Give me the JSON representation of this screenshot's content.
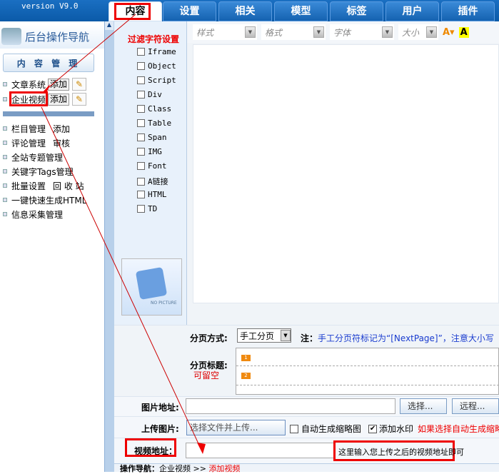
{
  "header": {
    "version": "version V9.0"
  },
  "tabs": [
    "内容",
    "设置",
    "相关",
    "模型",
    "标签",
    "用户",
    "插件"
  ],
  "sidebar": {
    "title": "后台操作导航",
    "section": "内 容 管 理",
    "modules": [
      {
        "label": "文章系统",
        "add": "添加"
      },
      {
        "label": "企业视频",
        "add": "添加"
      }
    ],
    "links": [
      [
        "栏目管理",
        "添加"
      ],
      [
        "评论管理",
        "审核"
      ],
      [
        "全站专题管理",
        ""
      ],
      [
        "关键字Tags管理",
        ""
      ],
      [
        "批量设置",
        "回 收 站"
      ],
      [
        "一键快速生成HTML",
        ""
      ],
      [
        "信息采集管理",
        ""
      ]
    ]
  },
  "filter": {
    "title": "过滤字符设置",
    "items": [
      "Iframe",
      "Object",
      "Script",
      "Div",
      "Class",
      "Table",
      "Span",
      "IMG",
      "Font",
      "A链接",
      "HTML",
      "TD"
    ]
  },
  "nopic": "NO PICTURE",
  "toolbar": {
    "style": "样式",
    "format": "格式",
    "font": "字体",
    "size": "大小"
  },
  "paging": {
    "label": "分页方式:",
    "value": "手工分页",
    "note_prefix": "注：",
    "note": "手工分页符标记为“[NextPage]”，注意大小写",
    "title_label": "分页标题:",
    "optional": "可留空",
    "tags": [
      "1",
      "2"
    ]
  },
  "image": {
    "label": "图片地址:",
    "select": "选择...",
    "remote": "远程..."
  },
  "upload": {
    "label": "上传图片:",
    "button": "选择文件并上传...",
    "thumb": "自动生成缩略图",
    "watermark": "添加水印",
    "hint": "如果选择自动生成缩略"
  },
  "video": {
    "label": "视频地址：",
    "annotation": "这里输入您上传之后的视频地址即可"
  },
  "breadcrumb": {
    "label": "操作导航：",
    "path": "企业视频",
    "sep": ">>",
    "current": "添加视频"
  },
  "colors": {
    "accent": "#1562b0",
    "annotation": "#e00000"
  }
}
